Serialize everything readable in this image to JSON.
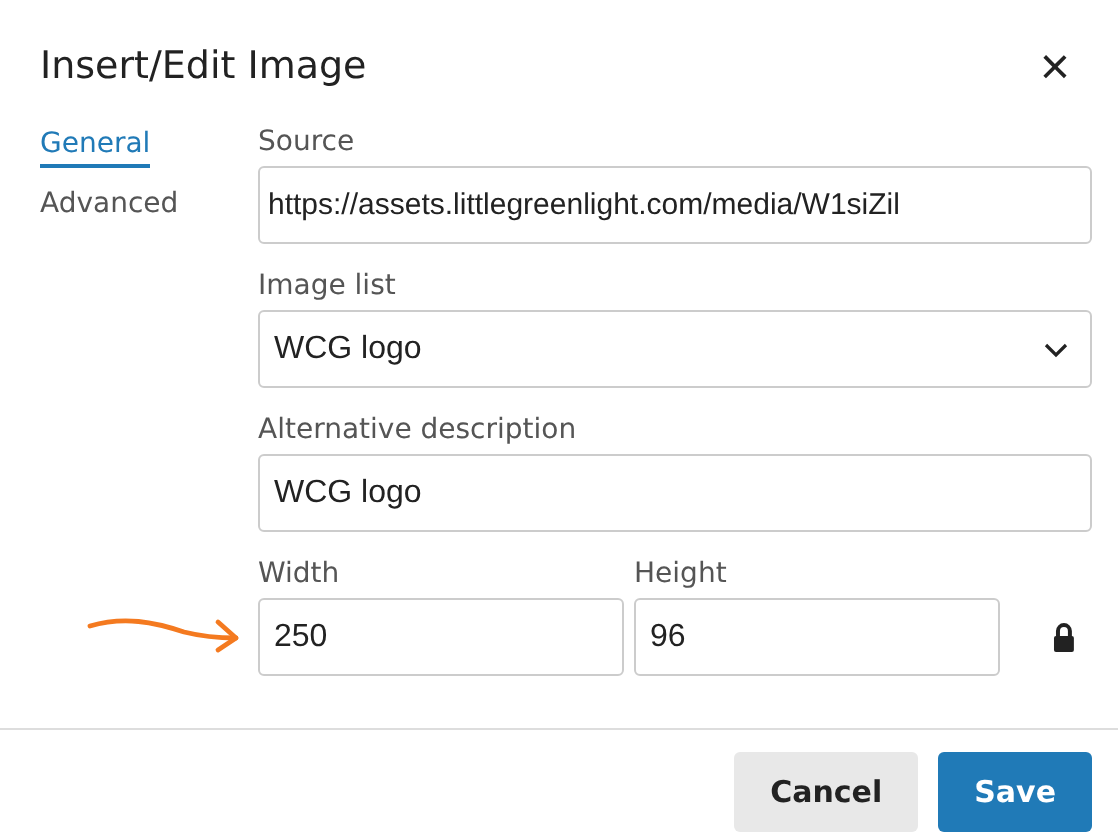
{
  "window": {
    "title": "Insert/Edit Image",
    "close": "×"
  },
  "tabs": [
    {
      "label": "General",
      "selected": true
    },
    {
      "label": "Advanced",
      "selected": false
    }
  ],
  "fields": [
    {
      "kind": "text",
      "label": "Source",
      "value": "https://assets.littlegreenlight.com/media/W1siZil"
    },
    {
      "kind": "select",
      "label": "Image list",
      "value": "WCG logo"
    },
    {
      "kind": "text",
      "label": "Alternative description",
      "value": "WCG logo"
    }
  ],
  "dimensions": {
    "width": {
      "label": "Width",
      "value": "250"
    },
    "height": {
      "label": "Height",
      "value": "96"
    },
    "locked": true
  },
  "annotation": {
    "kind": "arrow"
  },
  "buttons": [
    {
      "label": "Cancel",
      "kind": "secondary"
    },
    {
      "label": "Save",
      "kind": "primary"
    }
  ]
}
